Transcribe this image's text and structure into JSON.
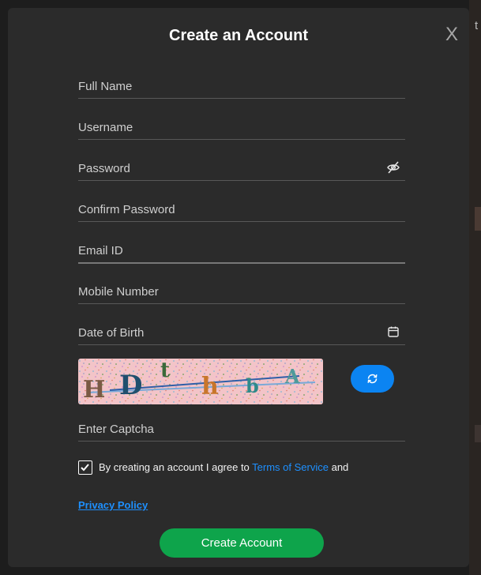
{
  "modal": {
    "title": "Create an Account",
    "close_label": "X"
  },
  "fields": {
    "full_name": {
      "placeholder": "Full Name",
      "value": ""
    },
    "username": {
      "placeholder": "Username",
      "value": ""
    },
    "password": {
      "placeholder": "Password",
      "value": "",
      "icon": "eye-slash-icon"
    },
    "confirm_password": {
      "placeholder": "Confirm Password",
      "value": ""
    },
    "email": {
      "placeholder": "Email ID",
      "value": ""
    },
    "mobile": {
      "placeholder": "Mobile Number",
      "value": ""
    },
    "dob": {
      "placeholder": "Date of Birth",
      "value": "",
      "icon": "calendar-icon"
    },
    "captcha": {
      "placeholder": "Enter Captcha",
      "value": ""
    }
  },
  "captcha_image": {
    "characters": [
      "H",
      "D",
      "t",
      "h",
      "b",
      "A"
    ],
    "background": "#f3c4c8"
  },
  "refresh_button": {
    "icon": "refresh-icon",
    "color": "#0b84f2"
  },
  "agreement": {
    "checked": true,
    "text_before": "By creating an account I agree to ",
    "terms_link": "Terms of Service",
    "text_after": " and",
    "privacy_link": "Privacy Policy"
  },
  "submit_button": {
    "label": "Create Account",
    "color": "#0ea44b"
  },
  "background": {
    "edge_text": "t"
  },
  "colors": {
    "modal_bg": "#2b2b2b",
    "link": "#1e90ff",
    "divider": "#585858"
  }
}
